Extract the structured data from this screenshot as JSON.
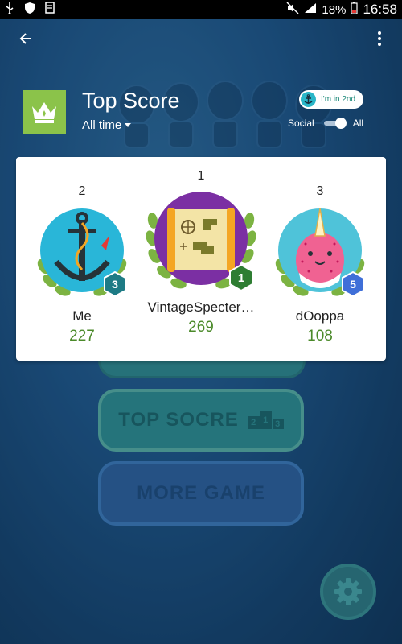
{
  "status_bar": {
    "battery_percent": "18%",
    "time": "16:58"
  },
  "app_bar": {
    "back_icon": "arrow-back-icon",
    "more_icon": "more-vert-icon"
  },
  "header": {
    "title": "Top Score",
    "timespan": "All time",
    "rank_chip": "I'm in 2nd",
    "social_label": "Social",
    "all_label": "All"
  },
  "leaderboard": [
    {
      "rank": "2",
      "name": "Me",
      "score": "227",
      "level": "3",
      "level_color": "#1e7b85"
    },
    {
      "rank": "1",
      "name": "VintageSpecter…",
      "score": "269",
      "level": "1",
      "level_color": "#2e7d32"
    },
    {
      "rank": "3",
      "name": "dOoppa",
      "score": "108",
      "level": "5",
      "level_color": "#3f6fd8"
    }
  ],
  "background": {
    "top_score_button": "TOP SOCRE",
    "podium_labels": [
      "2",
      "1",
      "3"
    ],
    "more_game_button": "MORE GAME",
    "settings_icon": "gear-icon"
  }
}
